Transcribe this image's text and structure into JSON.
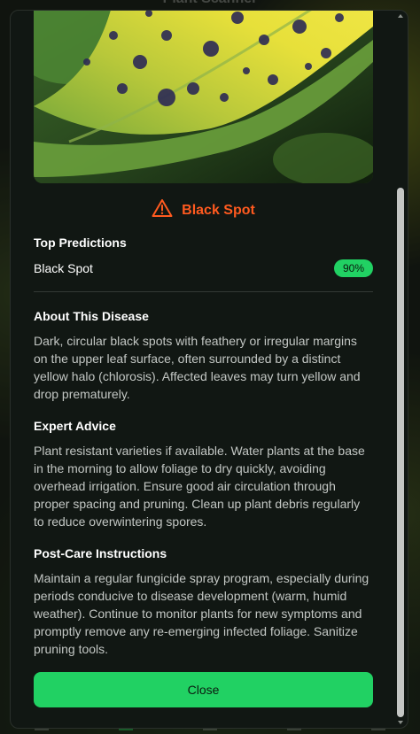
{
  "background": {
    "app_title": "Plant Scanner"
  },
  "modal": {
    "diagnosis": {
      "name": "Black Spot",
      "icon": "warning-triangle-icon",
      "color": "#ff5a1f"
    },
    "top_predictions": {
      "title": "Top Predictions",
      "items": [
        {
          "name": "Black Spot",
          "confidence": "90%"
        }
      ]
    },
    "about": {
      "title": "About This Disease",
      "text": "Dark, circular black spots with feathery or irregular margins on the upper leaf surface, often surrounded by a distinct yellow halo (chlorosis). Affected leaves may turn yellow and drop prematurely."
    },
    "expert_advice": {
      "title": "Expert Advice",
      "text": "Plant resistant varieties if available. Water plants at the base in the morning to allow foliage to dry quickly, avoiding overhead irrigation. Ensure good air circulation through proper spacing and pruning. Clean up plant debris regularly to reduce overwintering spores."
    },
    "post_care": {
      "title": "Post-Care Instructions",
      "text": "Maintain a regular fungicide spray program, especially during periods conducive to disease development (warm, humid weather). Continue to monitor plants for new symptoms and promptly remove any re-emerging infected foliage. Sanitize pruning tools."
    },
    "close_label": "Close",
    "accent_color": "#21d163"
  }
}
